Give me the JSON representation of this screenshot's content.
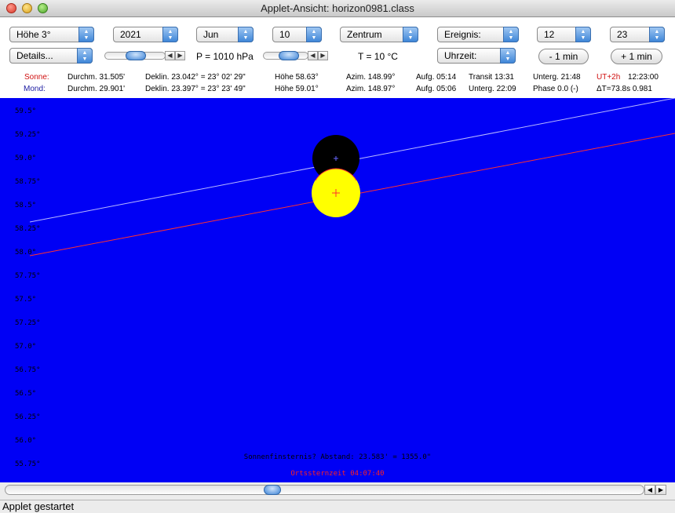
{
  "window": {
    "title": "Applet-Ansicht: horizon0981.class"
  },
  "controls": {
    "hoehe": "Höhe 3°",
    "year": "2021",
    "month": "Jun",
    "day": "10",
    "zentrum": "Zentrum",
    "ereignis": "Ereignis:",
    "hour": "12",
    "minute": "23",
    "details": "Details...",
    "pressure": "P = 1010 hPa",
    "temperature": "T = 10 °C",
    "uhrzeit": "Uhrzeit:",
    "minus_min": "- 1 min",
    "plus_min": "+ 1 min"
  },
  "info": {
    "sonne": {
      "label": "Sonne:",
      "durchm": "Durchm. 31.505'",
      "deklin": "Deklin. 23.042° = 23° 02' 29\"",
      "hoehe": "Höhe 58.63°",
      "azim": "Azim. 148.99°",
      "aufg": "Aufg. 05:14",
      "transit": "Transit 13:31",
      "unterg": "Unterg. 21:48",
      "ut": "UT+2h",
      "time": "12:23:00"
    },
    "mond": {
      "label": "Mond:",
      "durchm": "Durchm. 29.901'",
      "deklin": "Deklin. 23.397° = 23° 23' 49\"",
      "hoehe": "Höhe 59.01°",
      "azim": "Azim. 148.97°",
      "aufg": "Aufg. 05:06",
      "unterg": "Unterg. 22:09",
      "phase": "Phase 0.0 (-)",
      "delta": "ΔT=73.8s  0.981"
    }
  },
  "plot": {
    "y_ticks": [
      "59.5°",
      "59.25°",
      "59.0°",
      "58.75°",
      "58.5°",
      "58.25°",
      "58.0°",
      "57.75°",
      "57.5°",
      "57.25°",
      "57.0°",
      "56.75°",
      "56.5°",
      "56.25°",
      "56.0°",
      "55.75°"
    ],
    "eclipse_text": "Sonnenfinsternis? Abstand: 23.583' = 1355.0\"",
    "sidereal_text": "Ortssternzeit 04:07:40",
    "colors": {
      "background": "#0000f5",
      "sun": "#ffff00",
      "moon": "#000000",
      "sun_path": "#ff3030",
      "moon_path": "#b8b8ff"
    }
  },
  "status": "Applet gestartet"
}
